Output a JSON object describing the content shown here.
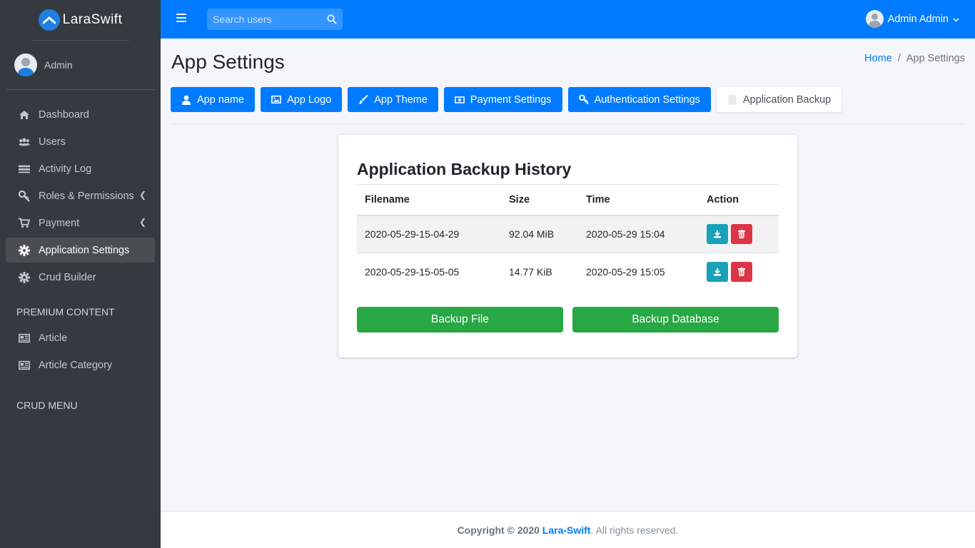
{
  "brand": {
    "name": "LaraSwift"
  },
  "sidebar": {
    "user_name": "Admin",
    "items": [
      {
        "label": "Dashboard",
        "icon": "home-icon"
      },
      {
        "label": "Users",
        "icon": "users-icon"
      },
      {
        "label": "Activity Log",
        "icon": "list-icon"
      },
      {
        "label": "Roles & Permissions",
        "icon": "key-icon"
      },
      {
        "label": "Payment",
        "icon": "cart-icon"
      },
      {
        "label": "Application Settings",
        "icon": "gear-icon"
      },
      {
        "label": "Crud Builder",
        "icon": "gear-icon"
      }
    ],
    "premium_header": "PREMIUM CONTENT",
    "premium_items": [
      {
        "label": "Article",
        "icon": "newspaper-icon"
      },
      {
        "label": "Article Category",
        "icon": "newspaper-icon"
      }
    ],
    "crud_header": "CRUD MENU"
  },
  "topbar": {
    "search_placeholder": "Search users",
    "user_name": "Admin Admin"
  },
  "page": {
    "title": "App Settings",
    "breadcrumb": {
      "home": "Home",
      "separator": "/",
      "current": "App Settings"
    }
  },
  "tabs": [
    {
      "label": "App name",
      "icon": "user-icon"
    },
    {
      "label": "App Logo",
      "icon": "image-icon"
    },
    {
      "label": "App Theme",
      "icon": "brush-icon"
    },
    {
      "label": "Payment Settings",
      "icon": "money-icon"
    },
    {
      "label": "Authentication Settings",
      "icon": "key-icon"
    },
    {
      "label": "Application Backup",
      "icon": "file-icon"
    }
  ],
  "backup": {
    "title": "Application Backup History",
    "columns": [
      "Filename",
      "Size",
      "Time",
      "Action"
    ],
    "rows": [
      {
        "filename": "2020-05-29-15-04-29",
        "size": "92.04 MiB",
        "time": "2020-05-29 15:04"
      },
      {
        "filename": "2020-05-29-15-05-05",
        "size": "14.77 KiB",
        "time": "2020-05-29 15:05"
      }
    ],
    "backup_file_label": "Backup File",
    "backup_db_label": "Backup Database"
  },
  "footer": {
    "prefix": "Copyright © 2020",
    "brand": "Lara-Swift",
    "suffix": ". All rights reserved."
  },
  "colors": {
    "primary": "#007bff",
    "sidebar": "#343a40",
    "success": "#28a745",
    "info": "#17a2b8",
    "danger": "#dc3545"
  }
}
